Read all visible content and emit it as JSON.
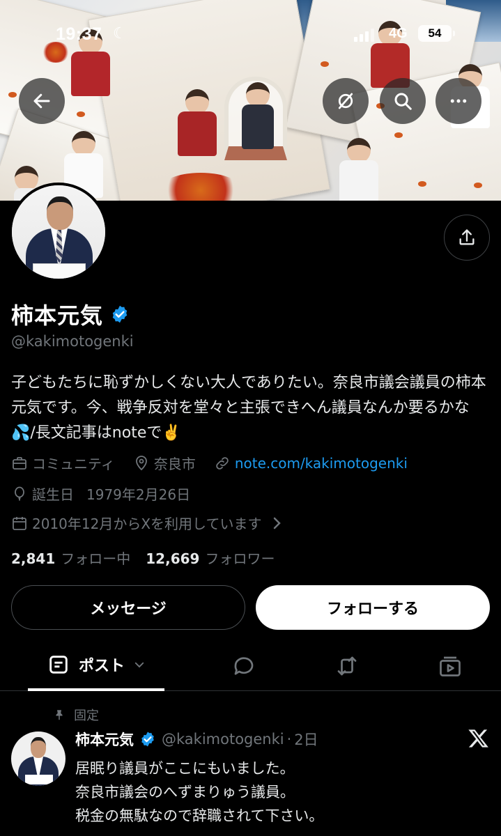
{
  "status_bar": {
    "time": "19:37",
    "network": "4G",
    "battery": "54"
  },
  "header": {
    "back_icon": "arrow-left-icon",
    "grok_icon": "grok-icon",
    "search_icon": "search-icon",
    "more_icon": "more-horizontal-icon"
  },
  "profile": {
    "display_name": "柿本元気",
    "handle": "@kakimotogenki",
    "bio": "子どもたちに恥ずかしくない大人でありたい。奈良市議会議員の柿本元気です。今、戦争反対を堂々と主張できへん議員なんか要るかな💦/長文記事はnoteで✌️",
    "category": "コミュニティ",
    "location": "奈良市",
    "website": "note.com/kakimotogenki",
    "birthday_label": "誕生日",
    "birthday": "1979年2月26日",
    "joined": "2010年12月からXを利用しています",
    "following_count": "2,841",
    "following_label": "フォロー中",
    "followers_count": "12,669",
    "followers_label": "フォロワー"
  },
  "actions": {
    "message_label": "メッセージ",
    "follow_label": "フォローする"
  },
  "tabs": {
    "posts_label": "ポスト",
    "replies_icon": "speech-bubble-icon",
    "reposts_icon": "repost-icon",
    "media_icon": "media-icon"
  },
  "pinned_post": {
    "pinned_label": "固定",
    "author_name": "柿本元気",
    "author_handle": "@kakimotogenki",
    "separator": "·",
    "time": "2日",
    "lines": [
      "居眠り議員がここにもいました。",
      "奈良市議会のへずまりゅう議員。",
      "税金の無駄なので辞職されて下さい。"
    ]
  },
  "colors": {
    "background": "#000000",
    "text_primary": "#e7e9ea",
    "text_secondary": "#71767b",
    "link": "#1d9bf0",
    "verified": "#1d9bf0"
  }
}
